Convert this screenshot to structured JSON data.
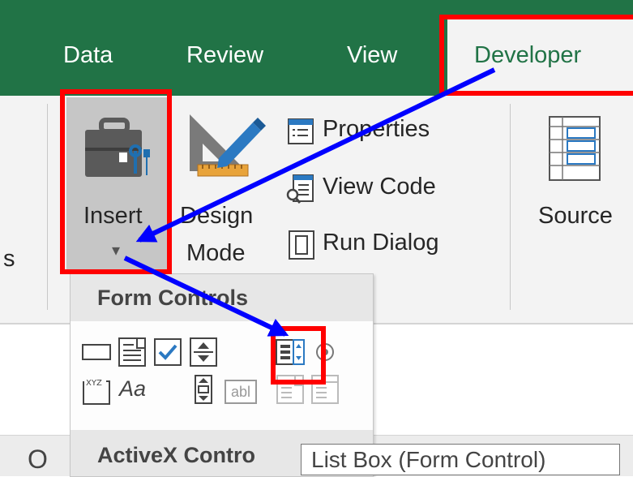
{
  "tabs": {
    "data": "Data",
    "review": "Review",
    "view": "View",
    "developer": "Developer"
  },
  "ribbon": {
    "left_fragment": "s",
    "insert_label": "Insert",
    "design_mode_line1": "Design",
    "design_mode_line2": "Mode",
    "properties": "Properties",
    "view_code": "View Code",
    "run_dialog": "Run Dialog",
    "source": "Source",
    "dropdown_arrow": "▾"
  },
  "dropdown": {
    "form_controls_title": "Form Controls",
    "activex_title": "ActiveX Contro",
    "label_control_glyph": "Aa",
    "text_field_glyph": "abl",
    "group_box_glyph": "XYZ"
  },
  "tooltip": {
    "text": "List Box (Form Control)"
  },
  "grid": {
    "column_letter": "O"
  },
  "colors": {
    "excel_green": "#217346",
    "ribbon_bg": "#f3f3f3",
    "highlight_red": "#ff0000",
    "arrow_blue": "#0000ff"
  }
}
